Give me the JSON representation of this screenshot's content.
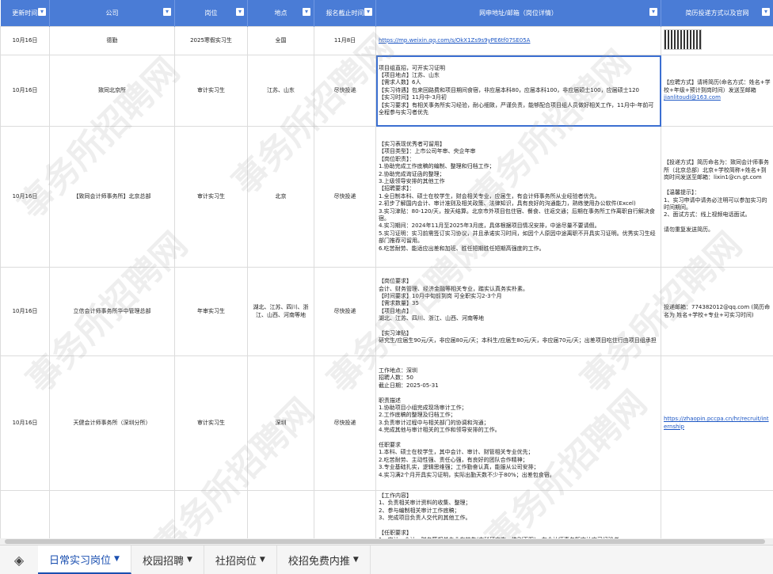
{
  "headers": [
    "更新时间",
    "公司",
    "岗位",
    "地点",
    "报名截止时间",
    "网申地址/邮箱（岗位详情）",
    "简历投递方式以及官网"
  ],
  "rows": [
    {
      "date": "10月16日",
      "company": "德勤",
      "position": "2025寒假实习生",
      "location": "全国",
      "deadline": "11月8日",
      "detail": "https://mp.weixin.qq.com/s/OkX1Zs9s9yPE6tf07SE05A",
      "contact": ""
    },
    {
      "date": "10月16日",
      "company": "致同北京所",
      "position": "审计实习生",
      "location": "江苏、山东",
      "deadline": "尽快投递",
      "detail": "项目组直招，可开实习证明\n【项目地点】江苏、山东\n【需求人数】6人\n【实习待遇】包来回路费和项目期间食宿，非应届本科80，应届本科100，非应届硕士100，应届硕士120\n【实习时间】11月中-3月初\n【实习要求】有相关事务所实习经验，耐心细致，严谨负责，能够配合项目组人员做好相关工作，11月中-年前可全程参与实习者优先",
      "contact": "【应聘方式】请将简历(命名方式：姓名+学校+年级+预计到岗时间）发送至邮箱 ",
      "email": "jianlitoudi@163.com"
    },
    {
      "date": "10月16日",
      "company": "【致同会计师事务所】北京总部",
      "position": "审计实习生",
      "location": "北京",
      "deadline": "尽快投递",
      "detail": "【实习表现优秀者可留用】\n【项目类型】：上市公司年审、央企年审\n【岗位职责】：\n1.协助完成工作底稿的编制、整理和归档工作；\n2.协助完成询证函的整理；\n3.上级领导安排的其他工作\n【招聘要求】：\n1.全日制本科、硕士在校学生，财会相关专业，应届生，有会计师事务所从业经验者优先。\n2.初步了解国内会计、审计准则及相关政策、法律知识，具有良好的沟通能力，熟练使用办公软件(Excel)\n3.实习津贴：80-120/天，按天结算。北京市外项目包住宿、餐食、往返交通；后期在事务所工作离职自行解决食宿。\n4.实习期间：2024年11月至2025年3月底，具体根据项目情况安排，中途尽量不要请假。\n5.实习证明：实习前需签订实习协议，并且承诺实习时间，如因个人原因中途离职不开具实习证明。优秀实习生经部门推荐可留用。\n6.吃苦耐劳、能适应出差和加班、胜任短期胜任短期高强度的工作。",
      "contact": "【投递方式】简历命名为：致同会计师事务所（北京总部）北京+学校简称+姓名+到岗时间发送至邮箱：lixin1@cn.gt.com\n\n【温馨提示】：\n1、实习申请中请务必注明可以参加实习的时间期间。\n2、面试方式：线上视频电话面试。\n\n请勿重复发送简历。",
      "email": ""
    },
    {
      "date": "10月16日",
      "company": "立信会计师事务所华中管理总部",
      "position": "年审实习生",
      "location": "湖北、江苏、四川、浙江、山西、河南等地",
      "deadline": "尽快投递",
      "detail": "【岗位要求】\n会计、财务管理、经济金融等相关专业，踏实认真务实朴素。\n【时间要求】10月中旬前到岗 可全职实习2-3个月\n【需求数量】35\n【项目地点】\n湖北、江苏、四川、浙江、山西、河南等地\n\n【实习津贴】\n研究生/应届生90元/天，非应届80元/天；本科生/应届生80元/天，非应届70元/天；出差项目吃住行由项目组承担",
      "contact": "投递邮箱：774382012@qq.com (简历命名为 姓名+学校+专业+可实习时间)",
      "email": ""
    },
    {
      "date": "10月16日",
      "company": "天健会计师事务所（深圳分所）",
      "position": "审计实习生",
      "location": "深圳",
      "deadline": "尽快投递",
      "detail": "工作地点：深圳\n招聘人数：50\n截止日期：2025-05-31\n\n职责描述\n1.协助项目小组完成现场审计工作；\n2.工作底稿的整理及归档工作；\n3.负责审计过程中与相关部门的协调和沟通；\n4.完成其他与审计相关的工作和领导安排的工作。\n\n任职要求\n1.本科、硕士在校学生，其中会计、审计、财管相关专业优先；\n2.吃苦耐劳、主动性强、责任心强，有良好的团队合作精神；\n3.专业基础扎实，逻辑思维强；工作勤奋认真，能服从公司安排；\n4.实习满2个月开具实习证明，实际出勤天数不少于80%；出差包食宿。",
      "contact": "https://zhaopin.pccpa.cn/hr/recruit/internship",
      "email": ""
    },
    {
      "date": "",
      "company": "",
      "position": "",
      "location": "",
      "deadline": "",
      "detail": "【工作内容】\n1、负责相关审计资料的收集、整理；\n2、参与编制相关审计工作底稿；\n3、完成项目负责人交代的其他工作。\n\n【任职要求】\n1、审计、会计、财务等相关专业在校生(本科研究生，性别不限)，有会计师事务所审计实习经验者",
      "contact": "",
      "email": ""
    }
  ],
  "watermark": "事务所招聘网",
  "tabs": [
    {
      "label": "日常实习岗位",
      "active": true
    },
    {
      "label": "校园招聘",
      "active": false
    },
    {
      "label": "社招岗位",
      "active": false
    },
    {
      "label": "校招免费内推",
      "active": false
    }
  ],
  "colors": {
    "header": "#4a7cd6",
    "link": "#1a55c4"
  }
}
